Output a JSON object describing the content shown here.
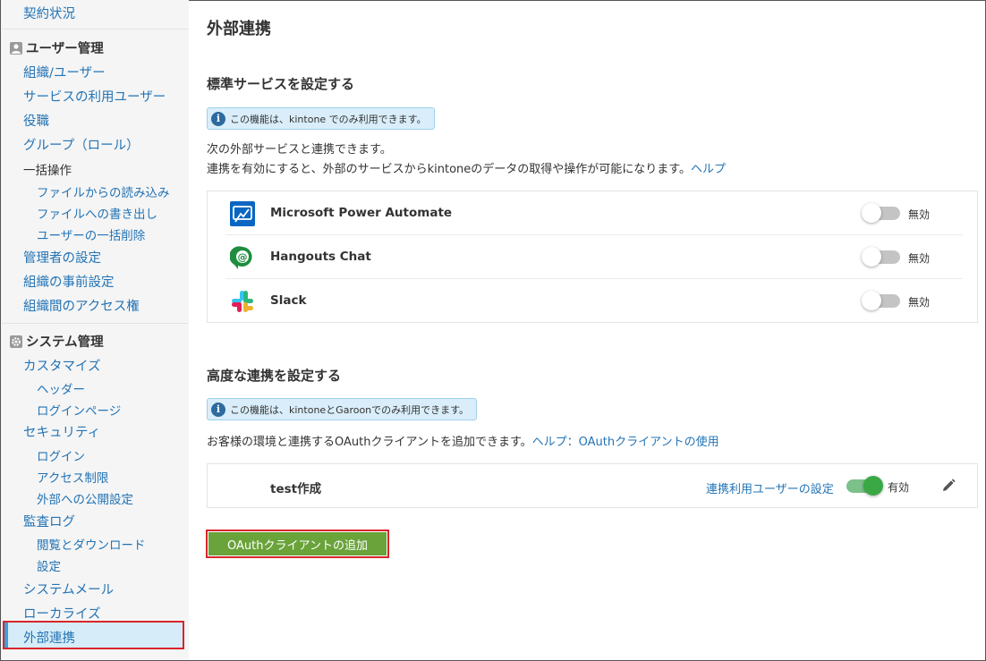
{
  "sidebar": {
    "contract": "契約状況",
    "user_mgmt": {
      "heading": "ユーザー管理",
      "items": {
        "org_users": "組織/ユーザー",
        "service_users": "サービスの利用ユーザー",
        "roles": "役職",
        "groups": "グループ（ロール）",
        "bulk": "一括操作",
        "import": "ファイルからの読み込み",
        "export": "ファイルへの書き出し",
        "bulk_delete": "ユーザーの一括削除",
        "admins": "管理者の設定",
        "org_preset": "組織の事前設定",
        "org_access": "組織間のアクセス権"
      }
    },
    "system_mgmt": {
      "heading": "システム管理",
      "items": {
        "customize": "カスタマイズ",
        "header": "ヘッダー",
        "login_page": "ログインページ",
        "security": "セキュリティ",
        "login": "ログイン",
        "access_limit": "アクセス制限",
        "public_settings": "外部への公開設定",
        "audit_log": "監査ログ",
        "view_download": "閲覧とダウンロード",
        "settings": "設定",
        "system_mail": "システムメール",
        "localize": "ローカライズ",
        "integration": "外部連携"
      }
    }
  },
  "main": {
    "title": "外部連携",
    "standard": {
      "title": "標準サービスを設定する",
      "info": "この機能は、kintone でのみ利用できます。",
      "desc1": "次の外部サービスと連携できます。",
      "desc2": "連携を有効にすると、外部のサービスからkintoneのデータの取得や操作が可能になります。",
      "help": "ヘルプ",
      "services": [
        {
          "name": "Microsoft Power Automate",
          "status": "無効",
          "icon": "power-automate-icon"
        },
        {
          "name": "Hangouts Chat",
          "status": "無効",
          "icon": "hangouts-chat-icon"
        },
        {
          "name": "Slack",
          "status": "無効",
          "icon": "slack-icon"
        }
      ]
    },
    "advanced": {
      "title": "高度な連携を設定する",
      "info": "この機能は、kintoneとGaroonでのみ利用できます。",
      "desc": "お客様の環境と連携するOAuthクライアントを追加できます。",
      "help": "ヘルプ：OAuthクライアントの使用",
      "client": {
        "name": "test作成",
        "user_setting_link": "連携利用ユーザーの設定",
        "status": "有効"
      },
      "add_button": "OAuthクライアントの追加"
    }
  },
  "colors": {
    "link": "#2474b5",
    "toggle_on": "#3aa845",
    "add_button": "#6aa33a",
    "highlight": "#d8252c"
  }
}
